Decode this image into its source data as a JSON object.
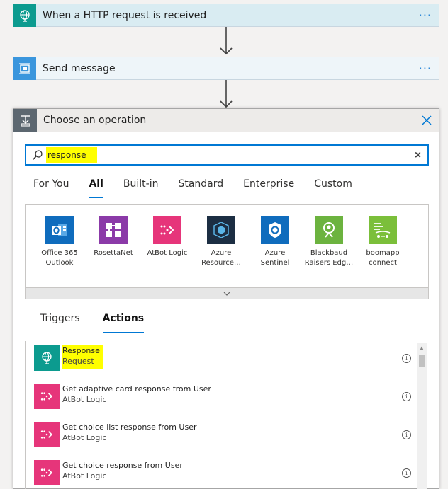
{
  "flow": {
    "http_step": {
      "title": "When a HTTP request is received",
      "more": "···"
    },
    "send_step": {
      "title": "Send message",
      "more": "···"
    }
  },
  "panel": {
    "title": "Choose an operation",
    "search": {
      "value": "response",
      "clear": "×"
    },
    "tabs": [
      "For You",
      "All",
      "Built-in",
      "Standard",
      "Enterprise",
      "Custom"
    ],
    "active_tab": "All",
    "connectors": [
      {
        "line1": "Office 365",
        "line2": "Outlook",
        "color": "#0f6cbd"
      },
      {
        "line1": "RosettaNet",
        "line2": "",
        "color": "#8b3aa8"
      },
      {
        "line1": "AtBot Logic",
        "line2": "",
        "color": "#e6357a"
      },
      {
        "line1": "Azure",
        "line2": "Resource…",
        "color": "#1c2e43"
      },
      {
        "line1": "Azure",
        "line2": "Sentinel",
        "color": "#0f6cbd"
      },
      {
        "line1": "Blackbaud",
        "line2": "Raisers Edg…",
        "color": "#6cb33f"
      },
      {
        "line1": "boomapp",
        "line2": "connect",
        "color": "#7bbf3a"
      }
    ],
    "subtabs": [
      "Triggers",
      "Actions"
    ],
    "active_subtab": "Actions",
    "actions": [
      {
        "name": "Response",
        "sub": "Request",
        "color": "#0c9b8f"
      },
      {
        "name": "Get adaptive card response from User",
        "sub": "AtBot Logic",
        "color": "#e6357a"
      },
      {
        "name": "Get choice list response from User",
        "sub": "AtBot Logic",
        "color": "#e6357a"
      },
      {
        "name": "Get choice response from User",
        "sub": "AtBot Logic",
        "color": "#e6357a"
      }
    ],
    "info_glyph": "i"
  },
  "colors": {
    "accent": "#0078d4",
    "highlight": "#ffff00",
    "teal": "#0c9b8f",
    "send_blue": "#3a96dd"
  }
}
